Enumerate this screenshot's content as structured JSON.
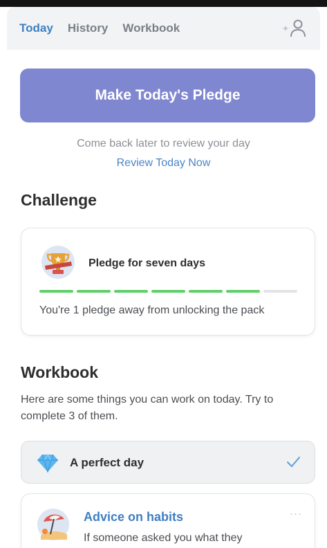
{
  "nav": {
    "tabs": [
      {
        "label": "Today",
        "active": true
      },
      {
        "label": "History",
        "active": false
      },
      {
        "label": "Workbook",
        "active": false
      }
    ],
    "profile_icon": "profile-sparkle-icon"
  },
  "pledge_button": {
    "label": "Make Today's Pledge"
  },
  "review": {
    "message": "Come back later to review your day",
    "link": "Review Today Now"
  },
  "challenge": {
    "heading": "Challenge",
    "title": "Pledge for seven days",
    "subtitle": "You're 1 pledge away from unlocking the pack",
    "progress": {
      "completed": 6,
      "total": 7
    },
    "icon": "trophy-icon"
  },
  "workbook": {
    "heading": "Workbook",
    "intro": "Here are some things you can work on today. Try to complete 3 of them.",
    "items": [
      {
        "label": "A perfect day",
        "completed": true,
        "icon": "diamond-icon"
      },
      {
        "label": "Advice on habits",
        "text": "If someone asked you what they",
        "completed": false,
        "icon": "beach-umbrella-icon",
        "more": "···"
      }
    ]
  },
  "colors": {
    "accent": "#3f7fc2",
    "pledge_button": "#8087d1",
    "progress_done": "#5fd068",
    "progress_todo": "#e3e4e6"
  }
}
